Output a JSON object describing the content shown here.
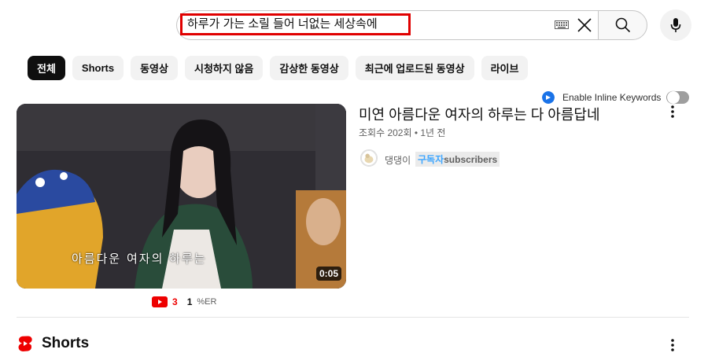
{
  "search": {
    "query": "하루가 가는 소릴 들어 너없는 세상속에"
  },
  "chips": [
    "전체",
    "Shorts",
    "동영상",
    "시청하지 않음",
    "감상한 동영상",
    "최근에 업로드된 동영상",
    "라이브"
  ],
  "inline_keywords": {
    "label": "Enable Inline Keywords"
  },
  "video": {
    "title": "미연 아름다운 여자의 하루는 다 아름답네",
    "meta": "조회수 202회 • 1년 전",
    "duration": "0:05",
    "subtitle": "아름다운 여자의 하루는",
    "channel": "댕댕이",
    "sub_badge_accent": "구독자",
    "sub_badge_rest": "subscribers",
    "stat_count": "3",
    "stat_value": "1",
    "stat_unit": "%ER"
  },
  "shorts_section": {
    "title": "Shorts"
  },
  "colors": {
    "accent_red": "#e00000",
    "chip_active": "#0f0f0f",
    "link_blue": "#3ea6ff"
  }
}
